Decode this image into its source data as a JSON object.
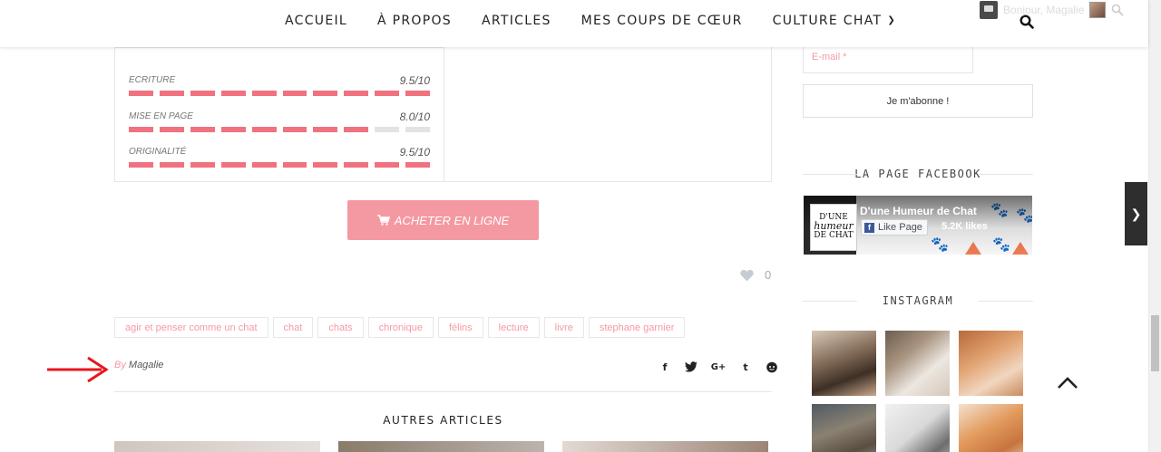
{
  "nav": {
    "links": [
      "ACCUEIL",
      "À PROPOS",
      "ARTICLES",
      "MES COUPS DE CŒUR",
      "CULTURE CHAT"
    ]
  },
  "admin": {
    "greeting": "Bonjour, Magalie"
  },
  "rating": {
    "criteria": [
      {
        "name": "ECRITURE",
        "score": "9.5/10",
        "level": 0.95
      },
      {
        "name": "MISE EN PAGE",
        "score": "8.0/10",
        "level": 0.8
      },
      {
        "name": "ORIGINALITÉ",
        "score": "9.5/10",
        "level": 0.95
      }
    ]
  },
  "buy": {
    "label": "ACHETER EN LIGNE"
  },
  "likes": {
    "count": "0"
  },
  "tags": [
    "agir et penser comme un chat",
    "chat",
    "chats",
    "chronique",
    "félins",
    "lecture",
    "livre",
    "stephane garnier"
  ],
  "byline": {
    "by": "By",
    "author": "Magalie"
  },
  "related": {
    "title": "AUTRES ARTICLES"
  },
  "sidebar": {
    "email_placeholder": "E-mail *",
    "subscribe_label": "Je m'abonne !",
    "facebook_heading": "LA PAGE FACEBOOK",
    "instagram_heading": "INSTAGRAM",
    "fb": {
      "page_name": "D'une Humeur de Chat",
      "like_label": "Like Page",
      "likes": "5.2K likes",
      "logo_lines": [
        "D'UNE",
        "humeur",
        "DE CHAT"
      ]
    }
  },
  "colors": {
    "accent": "#f0727f",
    "button": "#f499a2",
    "tag_text": "#f59aa3"
  }
}
